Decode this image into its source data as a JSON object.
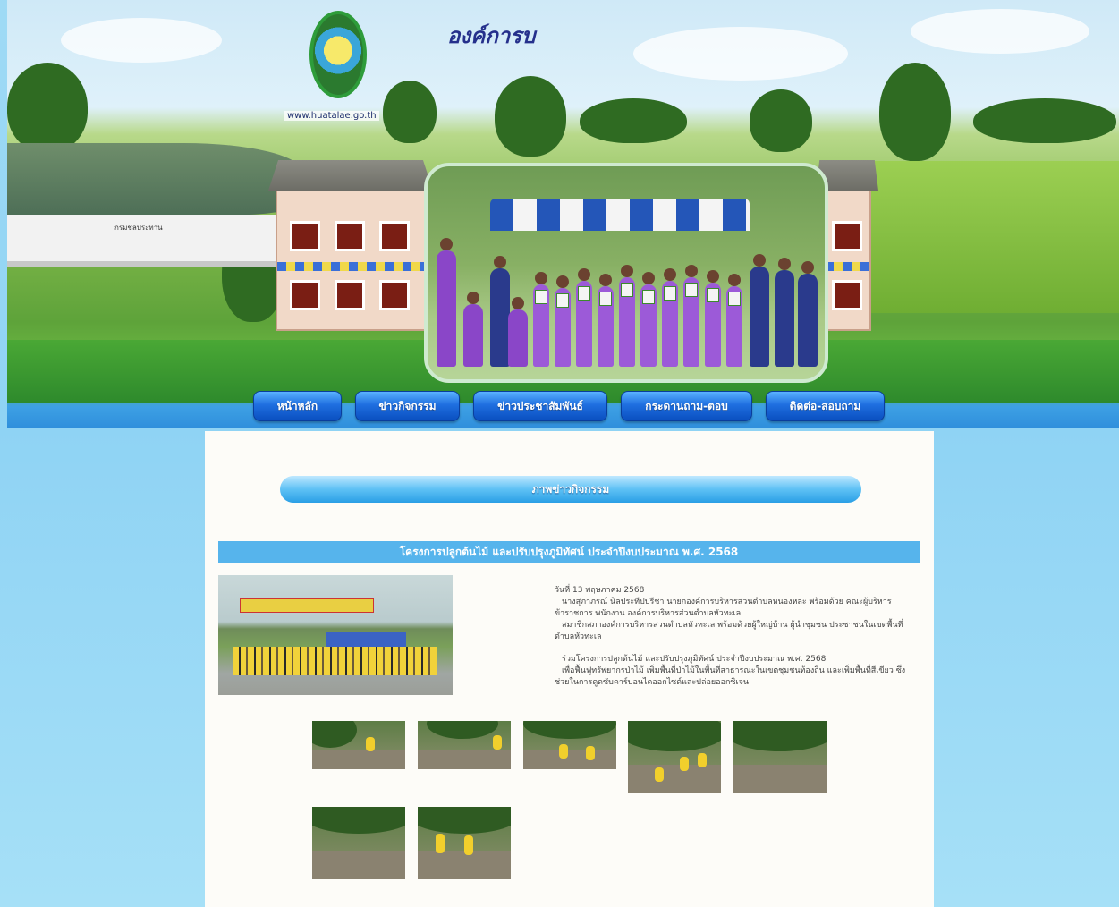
{
  "header": {
    "site_title": "องค์การบ",
    "url": "www.huatalae.go.th",
    "dam_label": "กรมชลประทาน"
  },
  "nav": {
    "items": [
      {
        "label": "หน้าหลัก"
      },
      {
        "label": "ข่าวกิจกรรม"
      },
      {
        "label": "ข่าวประชาสัมพันธ์"
      },
      {
        "label": "กระดานถาม-ตอบ"
      },
      {
        "label": "ติดต่อ-สอบถาม"
      }
    ]
  },
  "section": {
    "title": "ภาพข่าวกิจกรรม"
  },
  "news": {
    "title": "โครงการปลูกต้นไม้ และปรับปรุงภูมิทัศน์ ประจำปีงบประมาณ พ.ศ. 2568",
    "date": "วันที่ 13 พฤษภาคม 2568",
    "paragraphs": [
      "นางสุภาภรณ์ นิลประทีปปรีชา นายกองค์การบริหารส่วนตำบลหนองหละ พร้อมด้วย คณะผู้บริหาร ข้าราชการ พนักงาน องค์การบริหารส่วนตำบลหัวทะเล",
      "สมาชิกสภาองค์การบริหารส่วนตำบลหัวทะเล พร้อมด้วยผู้ใหญ่บ้าน ผู้นำชุมชน ประชาชนในเขตพื้นที่ตำบลหัวทะเล",
      "ร่วมโครงการปลูกต้นไม้ และปรับปรุงภูมิทัศน์ ประจำปีงบประมาณ พ.ศ. 2568",
      "เพื่อฟื้นฟูทรัพยากรป่าไม้ เพิ่มพื้นที่ป่าไม้ในพื้นที่สาธารณะในเขตชุมชนท้องถิ่น และเพิ่มพื้นที่สีเขียว ซึ่งช่วยในการดูดซับคาร์บอนไดออกไซด์และปล่อยออกซิเจน"
    ]
  },
  "colors": {
    "page_bg": "#8fd3f4",
    "content_bg": "#fdfcf8",
    "news_header": "#56b4ec",
    "nav_button": "#1f6fe0",
    "title_text": "#25308c"
  }
}
